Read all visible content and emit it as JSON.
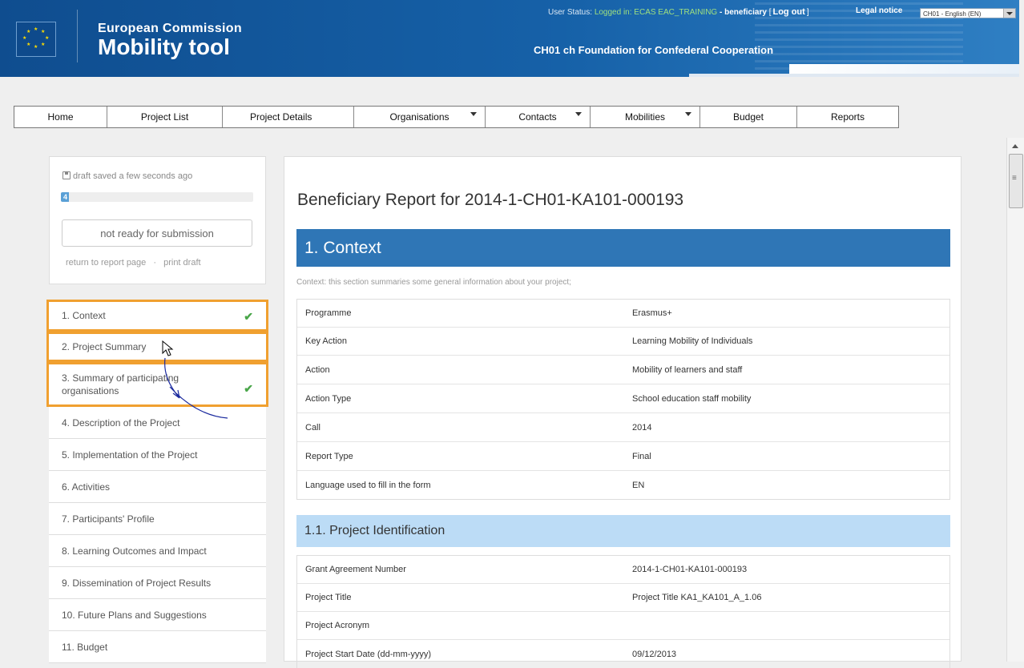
{
  "header": {
    "brand_top": "European Commission",
    "brand_main": "Mobility tool",
    "organisation": "CH01 ch Foundation for Confederal Cooperation",
    "status_prefix": "User Status:",
    "status_logged": "Logged in: ECAS EAC_TRAINING",
    "status_role": "- beneficiary",
    "logout": "Log out",
    "legal_notice": "Legal notice",
    "language": "CH01 - English (EN)"
  },
  "nav": {
    "items": [
      {
        "label": "Home"
      },
      {
        "label": "Project List"
      },
      {
        "label": "Project Details"
      },
      {
        "label": "Organisations"
      },
      {
        "label": "Contacts"
      },
      {
        "label": "Mobilities"
      },
      {
        "label": "Budget"
      },
      {
        "label": "Reports"
      }
    ]
  },
  "side": {
    "draft_status": "draft saved a few seconds ago",
    "progress_label": "4",
    "progress_percent": 4,
    "submission_status": "not ready for submission",
    "return_link": "return to report page",
    "sep": "·",
    "print_link": "print draft"
  },
  "steps": [
    {
      "label": "1. Context",
      "done": true
    },
    {
      "label": "2. Project Summary",
      "done": false
    },
    {
      "label": "3. Summary of participating organisations",
      "done": true
    },
    {
      "label": "4. Description of the Project",
      "done": false
    },
    {
      "label": "5. Implementation of the Project",
      "done": false
    },
    {
      "label": "6. Activities",
      "done": false
    },
    {
      "label": "7. Participants' Profile",
      "done": false
    },
    {
      "label": "8. Learning Outcomes and Impact",
      "done": false
    },
    {
      "label": "9. Dissemination of Project Results",
      "done": false
    },
    {
      "label": "10. Future Plans and Suggestions",
      "done": false
    },
    {
      "label": "11. Budget",
      "done": false
    }
  ],
  "main": {
    "title": "Beneficiary Report for 2014-1-CH01-KA101-000193",
    "section_title": "1. Context",
    "section_desc": "Context: this section summaries some general information about your project;",
    "context_rows": [
      {
        "k": "Programme",
        "v": "Erasmus+"
      },
      {
        "k": "Key Action",
        "v": "Learning Mobility of Individuals"
      },
      {
        "k": "Action",
        "v": "Mobility of learners and staff"
      },
      {
        "k": "Action Type",
        "v": "School education staff mobility"
      },
      {
        "k": "Call",
        "v": "2014"
      },
      {
        "k": "Report Type",
        "v": "Final"
      },
      {
        "k": "Language used to fill in the form",
        "v": "EN"
      }
    ],
    "subsection_title": "1.1. Project Identification",
    "ident_rows": [
      {
        "k": "Grant Agreement Number",
        "v": "2014-1-CH01-KA101-000193"
      },
      {
        "k": "Project Title",
        "v": "Project Title KA1_KA101_A_1.06"
      },
      {
        "k": "Project Acronym",
        "v": ""
      },
      {
        "k": "Project Start Date (dd-mm-yyyy)",
        "v": "09/12/2013"
      }
    ]
  },
  "colors": {
    "banner": "#1661a8",
    "section": "#2f76b6",
    "subsection": "#bcdcf6",
    "highlight": "#f0a030",
    "check": "#4aa64a"
  }
}
